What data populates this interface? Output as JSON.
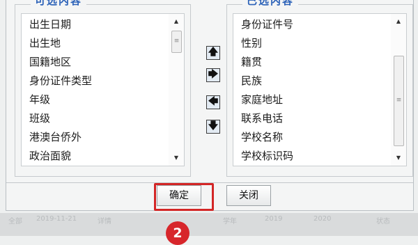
{
  "available": {
    "title": "可选内容",
    "items": [
      "出生日期",
      "出生地",
      "国籍地区",
      "身份证件类型",
      "年级",
      "班级",
      "港澳台侨外",
      "政治面貌"
    ]
  },
  "selected": {
    "title": "已选内容",
    "items": [
      "身份证件号",
      "性别",
      "籍贯",
      "民族",
      "家庭地址",
      "联系电话",
      "学校名称",
      "学校标识码"
    ]
  },
  "transfer_buttons": {
    "move_up": "🡅",
    "move_right": "🡆",
    "move_left": "🡄",
    "move_down": "🡇"
  },
  "scroll": {
    "up_glyph": "▲",
    "down_glyph": "▼",
    "grip_glyph": "≡"
  },
  "buttons": {
    "confirm": "确定",
    "close": "关闭"
  },
  "footer_faint": [
    "全部",
    "2019-11-21",
    "详情",
    "学年",
    "2019",
    "2020",
    "状态"
  ],
  "step_badge": "2",
  "colors": {
    "accent_title": "#2c62b8",
    "highlight": "#d32626",
    "badge": "#d7262b"
  }
}
